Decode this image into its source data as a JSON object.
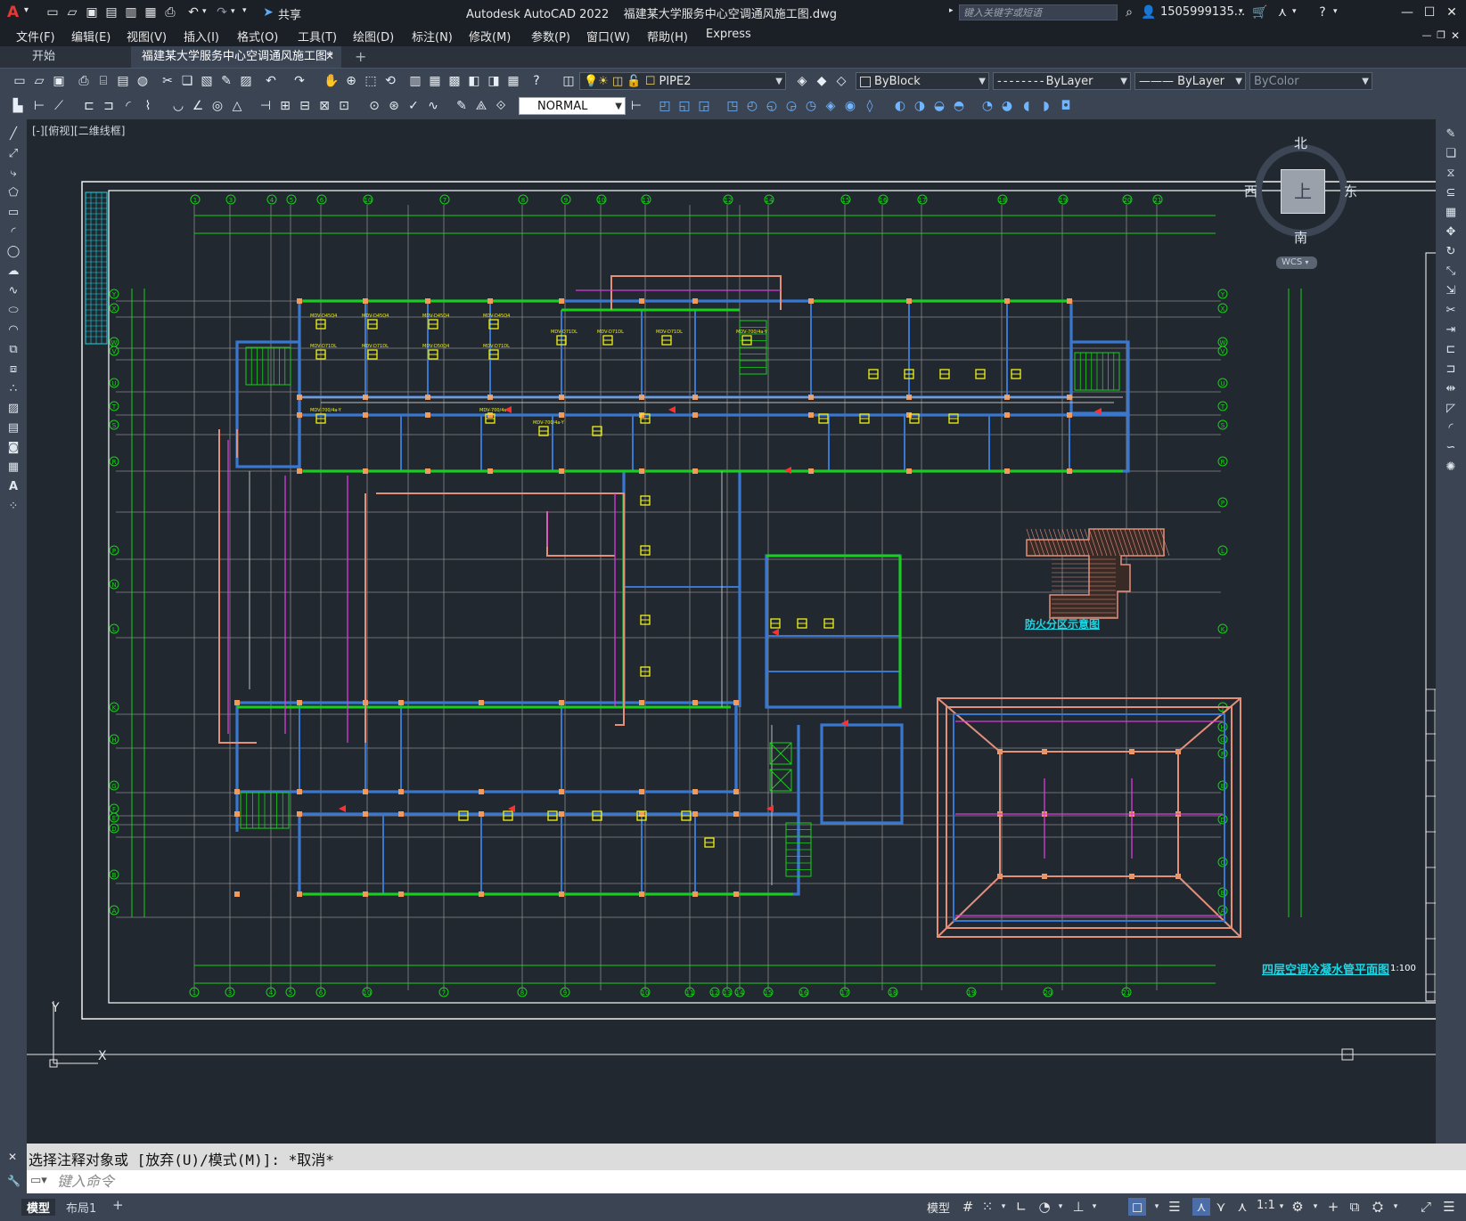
{
  "titlebar": {
    "app_logo": "A",
    "share_label": "共享",
    "title": "Autodesk AutoCAD 2022    福建某大学服务中心空调通风施工图.dwg",
    "search_placeholder": "键入关键字或短语",
    "user": "1505999135...",
    "icons": [
      "new-icon",
      "open-icon",
      "save-icon",
      "saveas-icon",
      "publish-icon",
      "plot-icon",
      "undo-icon",
      "redo-icon",
      "share-icon",
      "search-icon",
      "user-icon",
      "cart-icon",
      "help-icon",
      "minimize-icon",
      "maximize-icon",
      "close-icon"
    ]
  },
  "menubar": {
    "items": [
      "文件(F)",
      "编辑(E)",
      "视图(V)",
      "插入(I)",
      "格式(O)",
      "工具(T)",
      "绘图(D)",
      "标注(N)",
      "修改(M)",
      "参数(P)",
      "窗口(W)",
      "帮助(H)",
      "Express"
    ]
  },
  "tabs": {
    "start": "开始",
    "drawing": "福建某大学服务中心空调通风施工图*",
    "add": "+"
  },
  "toolbar": {
    "layer": "PIPE2",
    "color": "ByBlock",
    "linetype": "ByLayer",
    "lineweight": "ByLayer",
    "plotstyle": "ByColor",
    "dimstyle": "NORMAL"
  },
  "viewport": {
    "label": "[-][俯视][二维线框]",
    "viewcube": {
      "north": "北",
      "south": "南",
      "east": "东",
      "west": "西",
      "top": "上",
      "wcs": "WCS"
    },
    "ucs": {
      "x": "X",
      "y": "Y"
    }
  },
  "drawing": {
    "plan_title": "四层空调冷凝水管平面图",
    "plan_scale": "1:100",
    "fire_zone_title": "防火分区示意图",
    "colors": {
      "grid": "#8a8a8a",
      "walls": "#3a78d0",
      "axis": "#18d018",
      "equipment": "#f0f018",
      "ducts": "#d93cd9",
      "salmon": "#e3907a",
      "frame": "#ffffff",
      "cyan": "#18d8e6"
    },
    "top_axes": [
      "1",
      "3",
      "4",
      "5",
      "6",
      "10",
      "7",
      "8",
      "9",
      "10",
      "11",
      "12",
      "14",
      "15",
      "16",
      "17",
      "18",
      "19",
      "20",
      "21",
      "22",
      "23"
    ],
    "bottom_axes": [
      "1",
      "3",
      "4",
      "5",
      "6",
      "10",
      "7",
      "8",
      "9",
      "10",
      "11",
      "12",
      "13",
      "14",
      "15",
      "16",
      "17",
      "18",
      "19",
      "20",
      "21",
      "22",
      "23"
    ],
    "left_axes": [
      "Y",
      "X",
      "W",
      "V",
      "U",
      "T",
      "S",
      "R",
      "P",
      "N",
      "L",
      "K",
      "H",
      "G",
      "F",
      "E",
      "D",
      "B",
      "A"
    ],
    "right_axes": [
      "Y",
      "X",
      "W",
      "V",
      "U",
      "T",
      "S",
      "R",
      "P",
      "L",
      "K",
      "J",
      "H",
      "G",
      "F",
      "E",
      "D",
      "C",
      "B",
      "A"
    ],
    "room_tags": [
      "MDV-D45Q4",
      "MDV-D45Q4",
      "MDV-D45Q4",
      "MDV-D45Q4",
      "MDV-D71DL",
      "MDV-D71DL",
      "MDV-D50Q4",
      "MDV-D71DL",
      "MDV-D71DL",
      "MDV-D71DL",
      "MDV-D71DL",
      "MDV-700/4a-Y",
      "MDV-700/4a-Y",
      "MDV-700/4a-Y",
      "MDV-700/4a-Y"
    ]
  },
  "command": {
    "history": "选择注释对象或 [放弃(U)/模式(M)]: *取消*",
    "prompt": "键入命令"
  },
  "layout_tabs": [
    "模型",
    "布局1",
    "+"
  ],
  "status": {
    "model": "模型",
    "scale": "1:1"
  }
}
